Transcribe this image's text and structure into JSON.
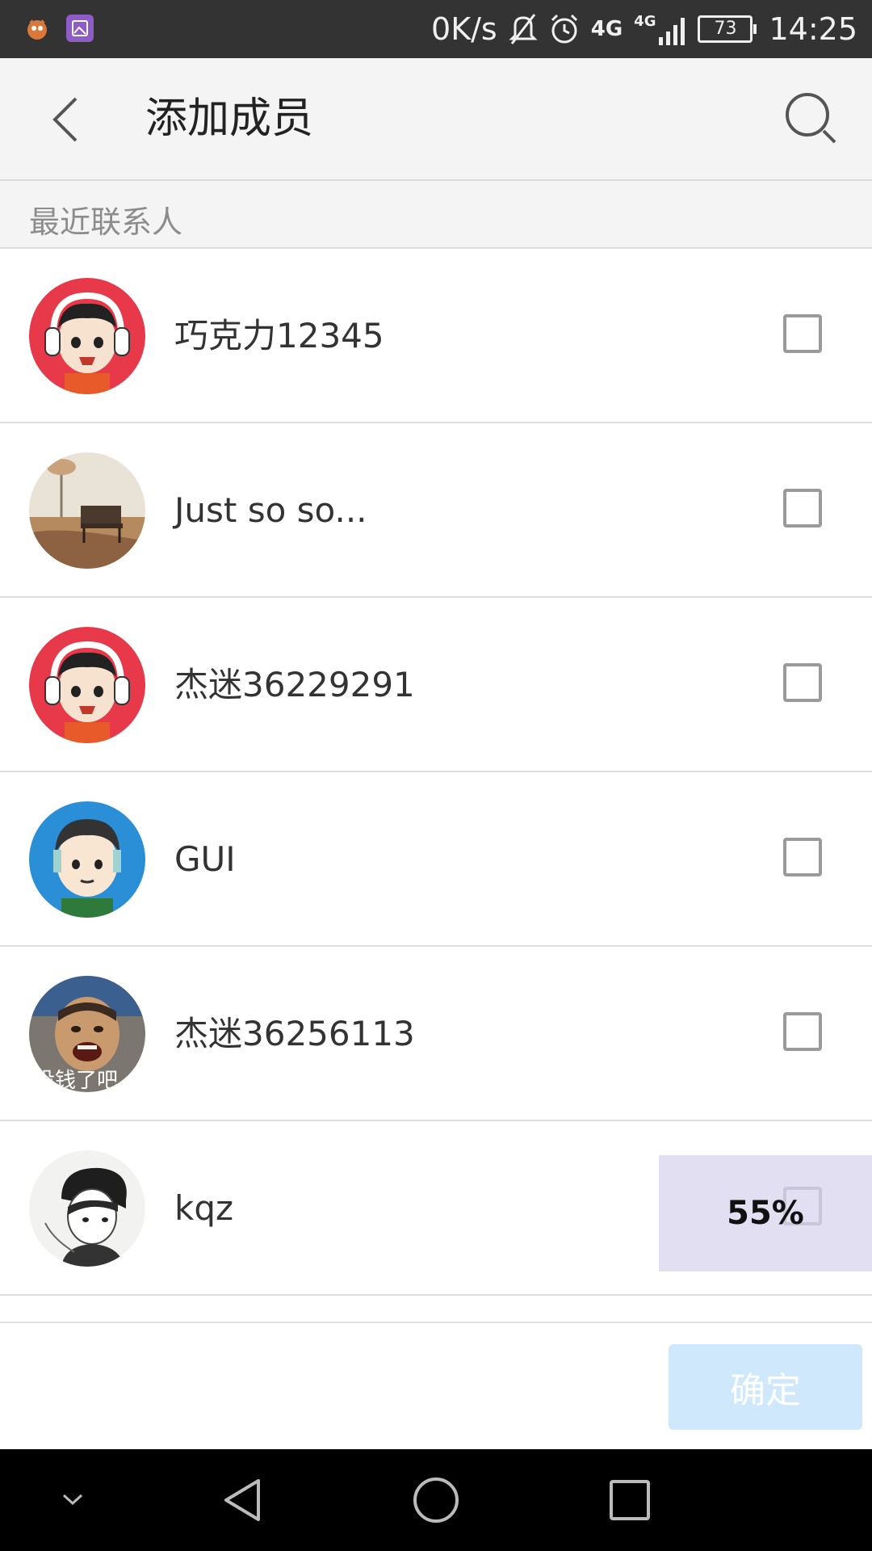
{
  "status_bar": {
    "network_speed": "0K/s",
    "network_type_1": "4G",
    "network_type_2": "4G",
    "battery": "73",
    "time": "14:25"
  },
  "app_bar": {
    "title": "添加成员"
  },
  "section": {
    "label": "最近联系人"
  },
  "contacts": [
    {
      "name": "巧克力12345",
      "avatar": "cartoon-headphones-red"
    },
    {
      "name": "Just so so...",
      "avatar": "park-bench-photo"
    },
    {
      "name": "杰迷36229291",
      "avatar": "cartoon-headphones-red"
    },
    {
      "name": "GUI",
      "avatar": "cartoon-boy-blue"
    },
    {
      "name": "杰迷36256113",
      "avatar": "meme-photo",
      "avatar_text": "没钱了吧"
    },
    {
      "name": "kqz",
      "avatar": "sketch-boy-cap"
    }
  ],
  "overlay": {
    "progress_text": "55%",
    "progress_value": 0.55
  },
  "footer": {
    "confirm_label": "确定"
  },
  "colors": {
    "status_bar_bg": "#333333",
    "app_bar_bg": "#f4f4f4",
    "confirm_button_bg": "#cfe8fb",
    "overlay_bg": "#d8d4ee"
  }
}
